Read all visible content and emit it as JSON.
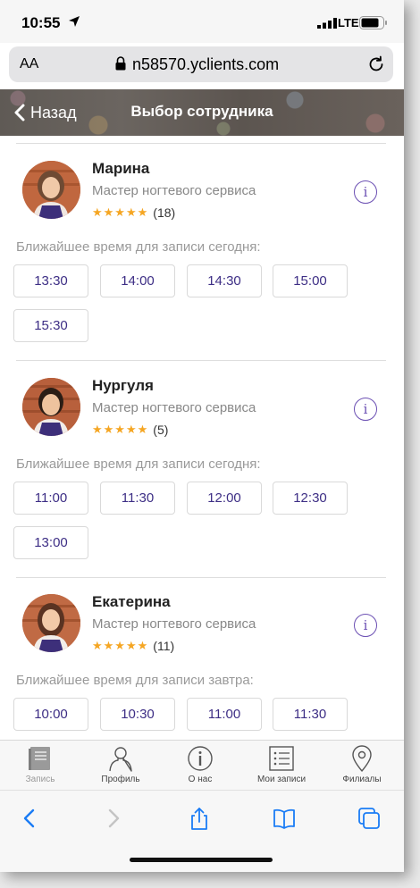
{
  "status_bar": {
    "time": "10:55",
    "network": "LTE"
  },
  "browser": {
    "aa_label": "AA",
    "url": "n58570.yclients.com"
  },
  "header": {
    "back_label": "Назад",
    "title": "Выбор сотрудника"
  },
  "employees": [
    {
      "name": "Марина",
      "role": "Мастер ногтевого сервиса",
      "stars": "★★★★★",
      "reviews": "(18)",
      "slots_title": "Ближайшее время для записи сегодня:",
      "slots": [
        "13:30",
        "14:00",
        "14:30",
        "15:00",
        "15:30"
      ]
    },
    {
      "name": "Нургуля",
      "role": "Мастер ногтевого сервиса",
      "stars": "★★★★★",
      "reviews": "(5)",
      "slots_title": "Ближайшее время для записи сегодня:",
      "slots": [
        "11:00",
        "11:30",
        "12:00",
        "12:30",
        "13:00"
      ]
    },
    {
      "name": "Екатерина",
      "role": "Мастер ногтевого сервиса",
      "stars": "★★★★★",
      "reviews": "(11)",
      "slots_title": "Ближайшее время для записи завтра:",
      "slots": [
        "10:00",
        "10:30",
        "11:00",
        "11:30"
      ]
    }
  ],
  "tab_bar": {
    "items": [
      {
        "label": "Запись",
        "icon": "book-icon"
      },
      {
        "label": "Профиль",
        "icon": "person-icon"
      },
      {
        "label": "О нас",
        "icon": "info-icon"
      },
      {
        "label": "Мои записи",
        "icon": "list-icon"
      },
      {
        "label": "Филиалы",
        "icon": "location-pin-icon"
      }
    ]
  },
  "colors": {
    "accent": "#3d2e85",
    "info": "#6b4fb3",
    "stars": "#f5a623",
    "safari_blue": "#1a7cf5"
  }
}
